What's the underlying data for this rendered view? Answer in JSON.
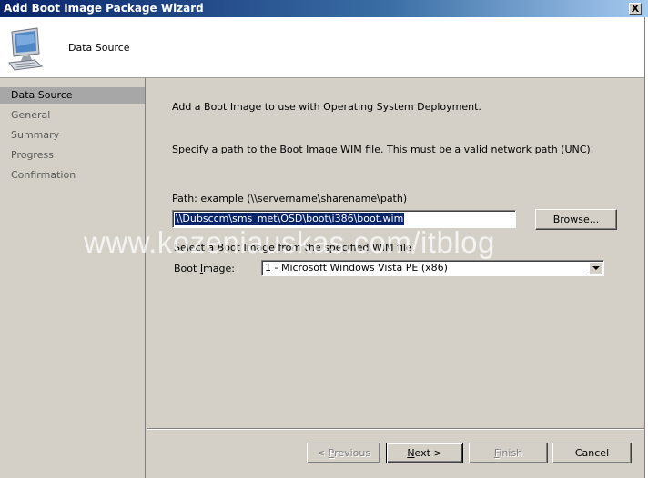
{
  "window": {
    "title": "Add Boot Image Package Wizard",
    "close_glyph": "X"
  },
  "header": {
    "title": "Data Source",
    "icon": "computer-monitor-icon"
  },
  "sidebar": {
    "items": [
      {
        "label": "Data Source",
        "active": true
      },
      {
        "label": "General",
        "active": false
      },
      {
        "label": "Summary",
        "active": false
      },
      {
        "label": "Progress",
        "active": false
      },
      {
        "label": "Confirmation",
        "active": false
      }
    ]
  },
  "content": {
    "intro": "Add a Boot Image to use with Operating System Deployment.",
    "instruction": "Specify a path to the Boot Image WIM file. This must be a valid network path (UNC).",
    "path_label": "Path: example (\\\\servername\\sharename\\path)",
    "path_value": "\\\\Dubsccm\\sms_met\\OSD\\boot\\i386\\boot.wim",
    "browse_label": "Browse...",
    "select_instruction": "Select a Boot Image from the specified WIM file.",
    "boot_image_label": "Boot Image:",
    "boot_image_label_pre": "Boot ",
    "boot_image_label_u": "I",
    "boot_image_label_post": "mage:",
    "boot_image_value": "1 - Microsoft Windows Vista PE (x86)"
  },
  "buttons": {
    "previous_pre": "< ",
    "previous_u": "P",
    "previous_post": "revious",
    "next_u": "N",
    "next_post": "ext >",
    "finish_u": "F",
    "finish_post": "inish",
    "cancel": "Cancel"
  },
  "watermark": "www.kozeniauskas.com/itblog"
}
